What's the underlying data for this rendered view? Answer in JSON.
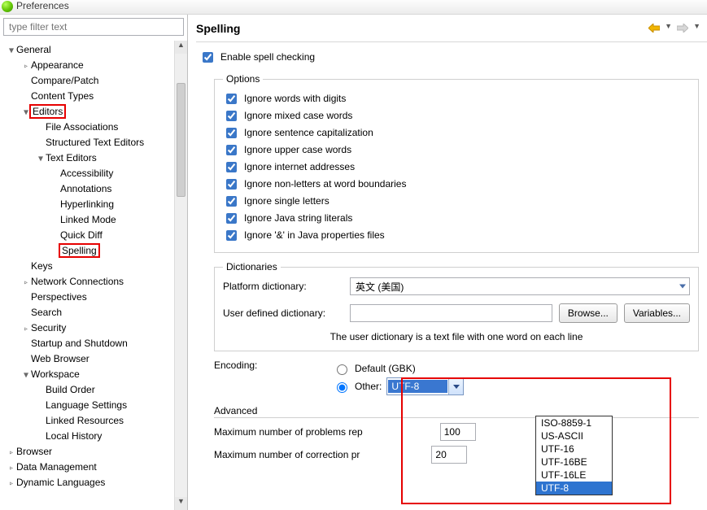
{
  "window_title": "Preferences",
  "filter_placeholder": "type filter text",
  "tree": [
    {
      "label": "General",
      "level": 0,
      "expander": "▼"
    },
    {
      "label": "Appearance",
      "level": 1,
      "expander": "▹"
    },
    {
      "label": "Compare/Patch",
      "level": 1,
      "expander": ""
    },
    {
      "label": "Content Types",
      "level": 1,
      "expander": ""
    },
    {
      "label": "Editors",
      "level": 1,
      "expander": "▼",
      "red": true
    },
    {
      "label": "File Associations",
      "level": 2,
      "expander": ""
    },
    {
      "label": "Structured Text Editors",
      "level": 2,
      "expander": ""
    },
    {
      "label": "Text Editors",
      "level": 2,
      "expander": "▼"
    },
    {
      "label": "Accessibility",
      "level": 3,
      "expander": ""
    },
    {
      "label": "Annotations",
      "level": 3,
      "expander": ""
    },
    {
      "label": "Hyperlinking",
      "level": 3,
      "expander": ""
    },
    {
      "label": "Linked Mode",
      "level": 3,
      "expander": ""
    },
    {
      "label": "Quick Diff",
      "level": 3,
      "expander": ""
    },
    {
      "label": "Spelling",
      "level": 3,
      "expander": "",
      "red": true
    },
    {
      "label": "Keys",
      "level": 1,
      "expander": ""
    },
    {
      "label": "Network Connections",
      "level": 1,
      "expander": "▹"
    },
    {
      "label": "Perspectives",
      "level": 1,
      "expander": ""
    },
    {
      "label": "Search",
      "level": 1,
      "expander": ""
    },
    {
      "label": "Security",
      "level": 1,
      "expander": "▹"
    },
    {
      "label": "Startup and Shutdown",
      "level": 1,
      "expander": ""
    },
    {
      "label": "Web Browser",
      "level": 1,
      "expander": ""
    },
    {
      "label": "Workspace",
      "level": 1,
      "expander": "▼"
    },
    {
      "label": "Build Order",
      "level": 2,
      "expander": ""
    },
    {
      "label": "Language Settings",
      "level": 2,
      "expander": ""
    },
    {
      "label": "Linked Resources",
      "level": 2,
      "expander": ""
    },
    {
      "label": "Local History",
      "level": 2,
      "expander": ""
    },
    {
      "label": "Browser",
      "level": 0,
      "expander": "▹"
    },
    {
      "label": "Data Management",
      "level": 0,
      "expander": "▹"
    },
    {
      "label": "Dynamic Languages",
      "level": 0,
      "expander": "▹"
    }
  ],
  "page": {
    "title": "Spelling",
    "enable_label": "Enable spell checking",
    "options_legend": "Options",
    "options": [
      "Ignore words with digits",
      "Ignore mixed case words",
      "Ignore sentence capitalization",
      "Ignore upper case words",
      "Ignore internet addresses",
      "Ignore non-letters at word boundaries",
      "Ignore single letters",
      "Ignore Java string literals",
      "Ignore '&' in Java properties files"
    ],
    "dict_legend": "Dictionaries",
    "platform_dict_label": "Platform dictionary:",
    "platform_dict_value": "英文 (美国)",
    "user_dict_label": "User defined dictionary:",
    "browse_label": "Browse...",
    "variables_label": "Variables...",
    "dict_hint": "The user dictionary is a text file with one word on each line",
    "encoding_label": "Encoding:",
    "enc_default_label": "Default (GBK)",
    "enc_other_label": "Other:",
    "enc_value": "UTF-8",
    "enc_options": [
      "ISO-8859-1",
      "US-ASCII",
      "UTF-16",
      "UTF-16BE",
      "UTF-16LE",
      "UTF-8"
    ],
    "advanced_label": "Advanced",
    "max_problems_label": "Maximum number of problems rep",
    "max_problems_value": "100",
    "max_corr_label": "Maximum number of correction pr",
    "max_corr_value": "20"
  }
}
